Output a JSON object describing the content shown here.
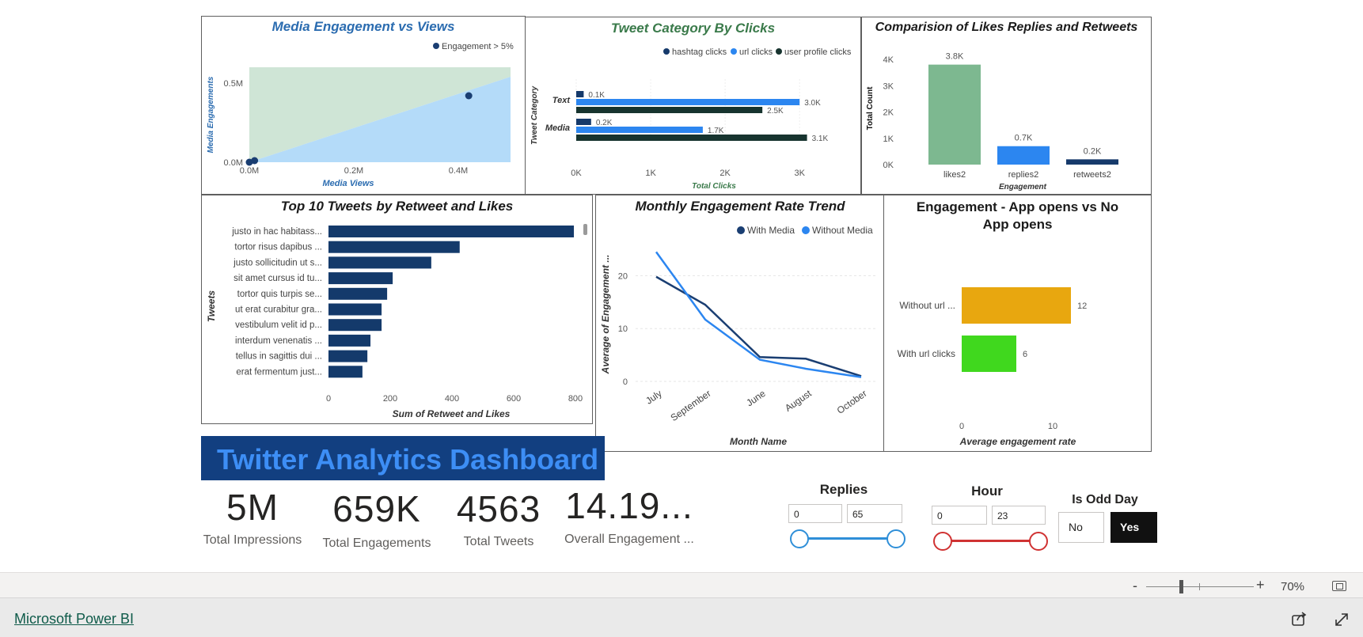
{
  "scatter": {
    "title": "Media Engagement vs Views",
    "legend": "Engagement > 5%",
    "xlabel": "Media Views",
    "ylabel": "Media Engagements",
    "xticks": [
      "0.0M",
      "0.2M",
      "0.4M"
    ],
    "yticks": [
      "0.0M",
      "0.5M"
    ],
    "colors": {
      "title": "#2b6cb0",
      "axis": "#2b6cb0",
      "upper": "#cfe5d6",
      "lower": "#b4dbf9",
      "point": "#1a3e72"
    }
  },
  "category": {
    "title": "Tweet Category By Clicks",
    "legend": [
      "hashtag clicks",
      "url clicks",
      "user profile clicks"
    ],
    "xlabel": "Total Clicks",
    "ylabel": "Tweet Category",
    "xticks": [
      "0K",
      "1K",
      "2K",
      "3K"
    ],
    "rows": [
      "Text",
      "Media"
    ],
    "labels": {
      "text": [
        "0.1K",
        "3.0K",
        "2.5K"
      ],
      "media": [
        "0.2K",
        "1.7K",
        "3.1K"
      ]
    },
    "colors": {
      "title": "#3a7a4a",
      "hashtag": "#163a6b",
      "url": "#2c86f0",
      "profile": "#17342f"
    }
  },
  "likes": {
    "title": "Comparision of Likes Replies and Retweets",
    "xlabel": "Engagement",
    "ylabel": "Total Count",
    "yticks": [
      "0K",
      "1K",
      "2K",
      "3K",
      "4K"
    ],
    "categories": [
      "likes2",
      "replies2",
      "retweets2"
    ],
    "labels": [
      "3.8K",
      "0.7K",
      "0.2K"
    ],
    "colors": [
      "#7db890",
      "#2c86f0",
      "#163a6b"
    ]
  },
  "top10": {
    "title": "Top 10 Tweets by Retweet and Likes",
    "xlabel": "Sum of Retweet and Likes",
    "ylabel": "Tweets",
    "xticks": [
      "0",
      "200",
      "400",
      "600",
      "800"
    ],
    "categories": [
      "justo in hac habitass...",
      "tortor risus dapibus ...",
      "justo sollicitudin ut s...",
      "sit amet cursus id tu...",
      "tortor quis turpis se...",
      "ut erat curabitur gra...",
      "vestibulum velit id p...",
      "interdum venenatis ...",
      "tellus in sagittis dui ...",
      "erat fermentum just..."
    ],
    "color": "#143a6b"
  },
  "trend": {
    "title": "Monthly Engagement Rate Trend",
    "legend": [
      "With Media",
      "Without Media"
    ],
    "xlabel": "Month Name",
    "ylabel": "Average of Engagement ...",
    "yticks": [
      "0",
      "10",
      "20"
    ],
    "categories": [
      "July",
      "September",
      "June",
      "August",
      "October"
    ],
    "colors": {
      "with": "#1a3e72",
      "without": "#2c86f0"
    }
  },
  "appopens": {
    "title": "Engagement - App opens vs No App opens",
    "xlabel": "Average engagement rate",
    "xticks": [
      "0",
      "10"
    ],
    "categories": [
      "Without url ...",
      "With url clicks"
    ],
    "labels": [
      "12",
      "6"
    ],
    "colors": [
      "#e8a70f",
      "#40d81e"
    ]
  },
  "banner": {
    "title": "Twitter Analytics Dashboard",
    "bg": "#123f80",
    "fg": "#3d8ef5"
  },
  "kpis": [
    {
      "value": "5M",
      "label": "Total Impressions"
    },
    {
      "value": "659K",
      "label": "Total Engagements"
    },
    {
      "value": "4563",
      "label": "Total Tweets"
    },
    {
      "value": "14.19...",
      "label": "Overall Engagement ..."
    }
  ],
  "slicers": {
    "replies": {
      "title": "Replies",
      "min": "0",
      "max": "65",
      "color": "#2f8fd8"
    },
    "hour": {
      "title": "Hour",
      "min": "0",
      "max": "23",
      "color": "#d03232"
    },
    "oddday": {
      "title": "Is Odd Day",
      "options": [
        "No",
        "Yes"
      ],
      "selected": "Yes"
    }
  },
  "zoom": {
    "minus": "-",
    "plus": "+",
    "level": "70%"
  },
  "footer": {
    "brand": "Microsoft Power BI"
  },
  "chart_data": [
    {
      "type": "scatter",
      "title": "Media Engagement vs Views",
      "xlabel": "Media Views",
      "ylabel": "Media Engagements",
      "series": [
        {
          "name": "Engagement > 5%",
          "x": [
            0.0,
            0.01,
            0.42
          ],
          "y": [
            0.0,
            0.01,
            0.42
          ]
        }
      ],
      "xlim": [
        0,
        0.5
      ],
      "ylim": [
        0,
        0.6
      ]
    },
    {
      "type": "bar",
      "title": "Tweet Category By Clicks",
      "categories": [
        "Text",
        "Media"
      ],
      "series": [
        {
          "name": "hashtag clicks",
          "values": [
            0.1,
            0.2
          ]
        },
        {
          "name": "url clicks",
          "values": [
            3.0,
            1.7
          ]
        },
        {
          "name": "user profile clicks",
          "values": [
            2.5,
            3.1
          ]
        }
      ],
      "xlabel": "Total Clicks",
      "ylabel": "Tweet Category",
      "xlim": [
        0,
        3.2
      ]
    },
    {
      "type": "bar",
      "title": "Comparision of Likes Replies and Retweets",
      "categories": [
        "likes2",
        "replies2",
        "retweets2"
      ],
      "values": [
        3.8,
        0.7,
        0.2
      ],
      "xlabel": "Engagement",
      "ylabel": "Total Count",
      "ylim": [
        0,
        4
      ]
    },
    {
      "type": "bar",
      "title": "Top 10 Tweets by Retweet and Likes",
      "categories": [
        "justo in hac habitass...",
        "tortor risus dapibus ...",
        "justo sollicitudin ut s...",
        "sit amet cursus id tu...",
        "tortor quis turpis se...",
        "ut erat curabitur gra...",
        "vestibulum velit id p...",
        "interdum venenatis ...",
        "tellus in sagittis dui ...",
        "erat fermentum just..."
      ],
      "values": [
        795,
        425,
        333,
        208,
        190,
        172,
        172,
        136,
        126,
        110
      ],
      "xlabel": "Sum of Retweet and Likes",
      "ylabel": "Tweets",
      "xlim": [
        0,
        800
      ]
    },
    {
      "type": "line",
      "title": "Monthly Engagement Rate Trend",
      "categories": [
        "July",
        "September",
        "June",
        "August",
        "October"
      ],
      "series": [
        {
          "name": "With Media",
          "values": [
            19.8,
            14.5,
            4.6,
            4.3,
            1.0
          ]
        },
        {
          "name": "Without Media",
          "values": [
            24.5,
            11.7,
            4.1,
            2.4,
            0.8
          ]
        }
      ],
      "xlabel": "Month Name",
      "ylabel": "Average of Engagement ...",
      "ylim": [
        0,
        25
      ]
    },
    {
      "type": "bar",
      "title": "Engagement - App opens vs No App opens",
      "categories": [
        "Without url ...",
        "With url clicks"
      ],
      "values": [
        12,
        6
      ],
      "xlabel": "Average engagement rate",
      "xlim": [
        0,
        20
      ]
    }
  ]
}
